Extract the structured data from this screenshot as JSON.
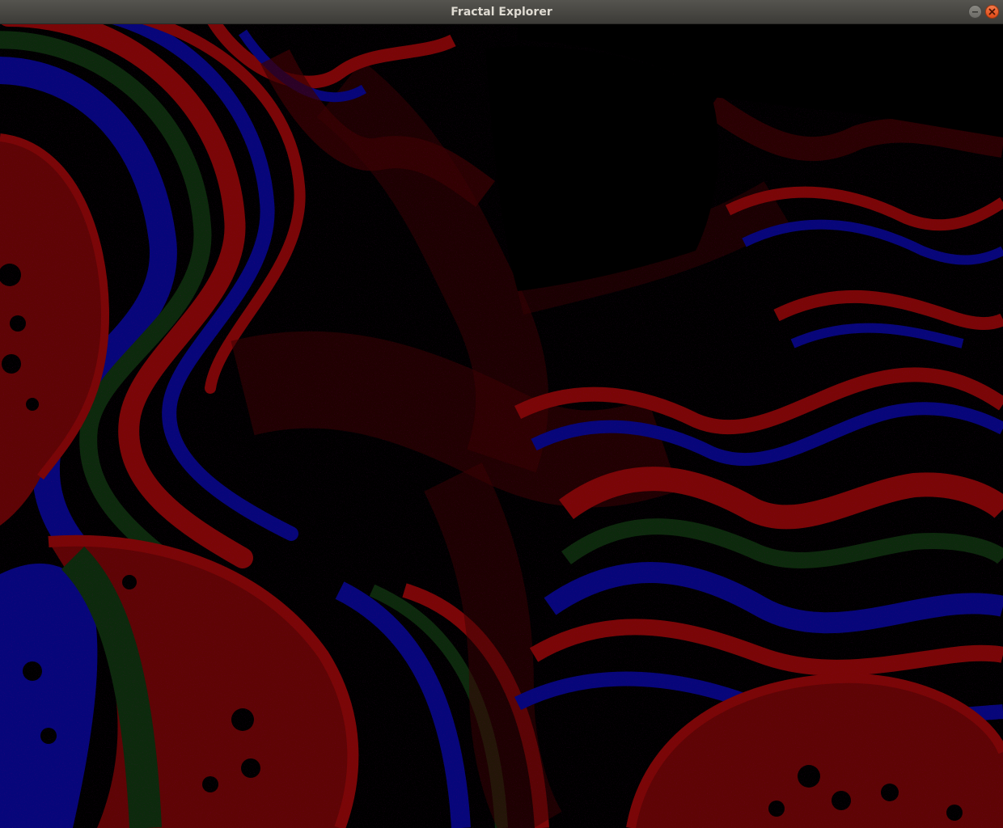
{
  "window": {
    "title": "Fractal Explorer"
  },
  "titlebar_buttons": {
    "minimize_icon": "minimize-icon",
    "close_icon": "close-icon"
  },
  "fractal": {
    "palette": {
      "background": "#000000",
      "red": "#7a0606",
      "dark_red": "#3a0202",
      "green": "#0c2a0c",
      "blue": "#06067a",
      "dark_blue": "#030340"
    }
  }
}
